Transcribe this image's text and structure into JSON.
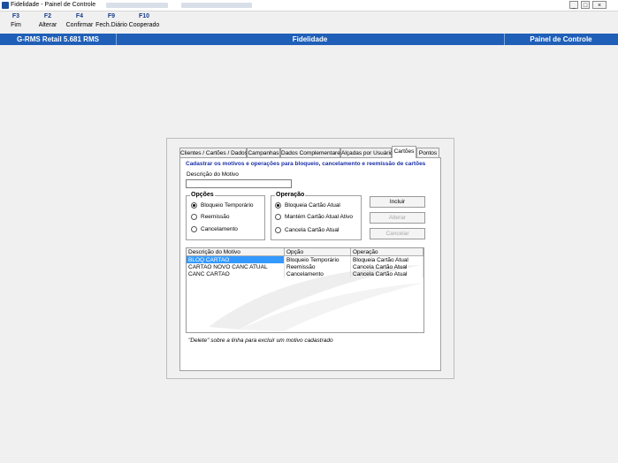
{
  "window": {
    "title": "Fidelidade - Painel de Controle",
    "minimize": "_",
    "maximize": "□",
    "close": "×"
  },
  "fkeys": [
    {
      "key": "F3",
      "label": "Fim"
    },
    {
      "key": "F2",
      "label": "Alterar"
    },
    {
      "key": "F4",
      "label": "Confirmar"
    },
    {
      "key": "F9",
      "label": "Fech.Diário"
    },
    {
      "key": "F10",
      "label": "Cooperado"
    }
  ],
  "statusbar": {
    "version": "G-RMS Retail 5.681 RMS",
    "module": "Fidelidade",
    "screen": "Painel de Controle"
  },
  "tabs": [
    "Clientes / Cartões / Dados",
    "Campanhas",
    "Dados Complementares",
    "Alçadas por Usuário",
    "Cartões",
    "Pontos"
  ],
  "page": {
    "headline": "Cadastrar os motivos e operações para bloqueio, cancelamento e reemissão de cartões",
    "motivo_label": "Descrição do Motivo",
    "motivo_value": "",
    "opcoes": {
      "title": "Opções",
      "items": [
        "Bloqueio Temporário",
        "Reemissão",
        "Cancelamento"
      ],
      "selected": 0
    },
    "operacao": {
      "title": "Operação",
      "items": [
        "Bloqueia Cartão Atual",
        "Mantém Cartão Atual Ativo",
        "Cancela Cartão Atual"
      ],
      "selected": 0
    },
    "buttons": {
      "incluir": "Incluir",
      "alterar": "Alterar",
      "cancelar": "Cancelar"
    },
    "grid": {
      "headers": [
        "Descrição do Motivo",
        "Opção",
        "Operação"
      ],
      "rows": [
        [
          "BLOQ CARTAO",
          "Bloqueio Temporário",
          "Bloqueia Cartão Atual"
        ],
        [
          "CARTAO NOVO CANC ATUAL",
          "Reemissão",
          "Cancela Cartão Atual"
        ],
        [
          "CANC CARTAO",
          "Cancelamento",
          "Cancela Cartão Atual"
        ]
      ]
    },
    "hint": "\"Delete\" sobre a linha para excluir um motivo cadastrado"
  },
  "colors": {
    "accent": "#1f5fb8",
    "headline": "#1a2fa8",
    "selection": "#3399ff"
  }
}
